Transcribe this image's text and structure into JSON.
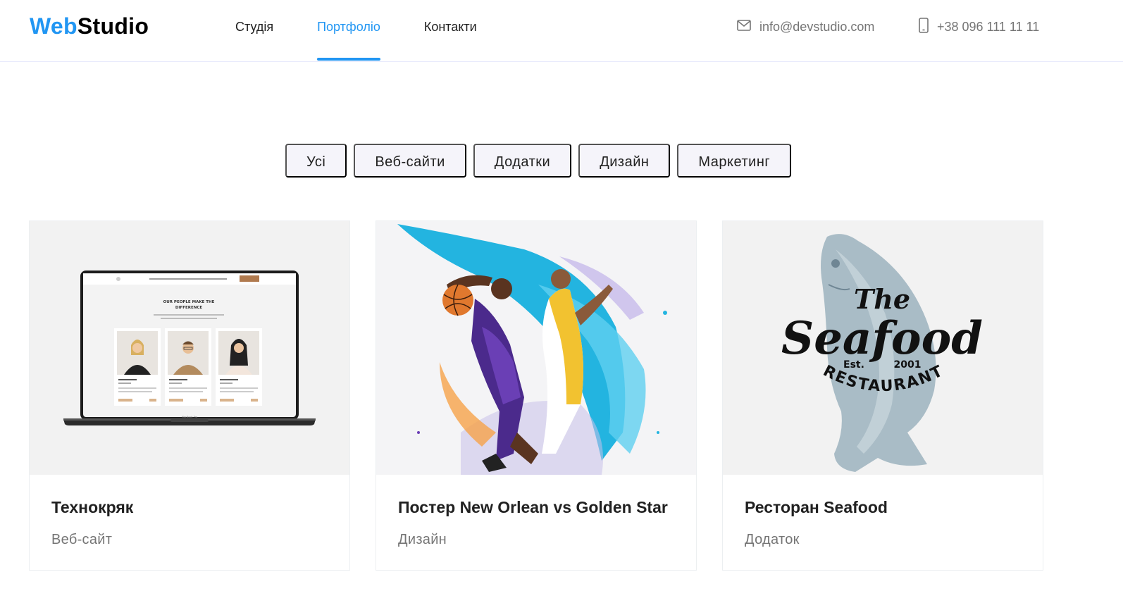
{
  "logo": {
    "part1": "Web",
    "part2": "Studio"
  },
  "nav": {
    "items": [
      {
        "label": "Студія",
        "active": false
      },
      {
        "label": "Портфоліо",
        "active": true
      },
      {
        "label": "Контакти",
        "active": false
      }
    ]
  },
  "contacts": {
    "email": "info@devstudio.com",
    "phone": "+38 096 111 11 11",
    "email_icon": "envelope-icon",
    "phone_icon": "smartphone-icon"
  },
  "filters": [
    "Усі",
    "Веб-сайти",
    "Додатки",
    "Дизайн",
    "Маркетинг"
  ],
  "portfolio": [
    {
      "title": "Технокряк",
      "category": "Веб-сайт",
      "image": "laptop-mockup",
      "mockup": {
        "heading_line1": "OUR PEOPLE MAKE THE",
        "heading_line2": "DIFFERENCE",
        "brand": "MacBook Pro"
      }
    },
    {
      "title": "Постер New Orlean vs Golden Star",
      "category": "Дизайн",
      "image": "basketball-poster"
    },
    {
      "title": "Ресторан Seafood",
      "category": "Додаток",
      "image": "seafood-logo",
      "logo_text": {
        "the": "The",
        "main": "Seafood",
        "est": "Est.",
        "year": "2001",
        "sub": "RESTAURANT"
      }
    }
  ],
  "colors": {
    "accent": "#2196f3",
    "text": "#212121",
    "muted": "#757575",
    "filter_bg": "#f5f4fa",
    "thumb_bg": "#f2f2f2"
  }
}
